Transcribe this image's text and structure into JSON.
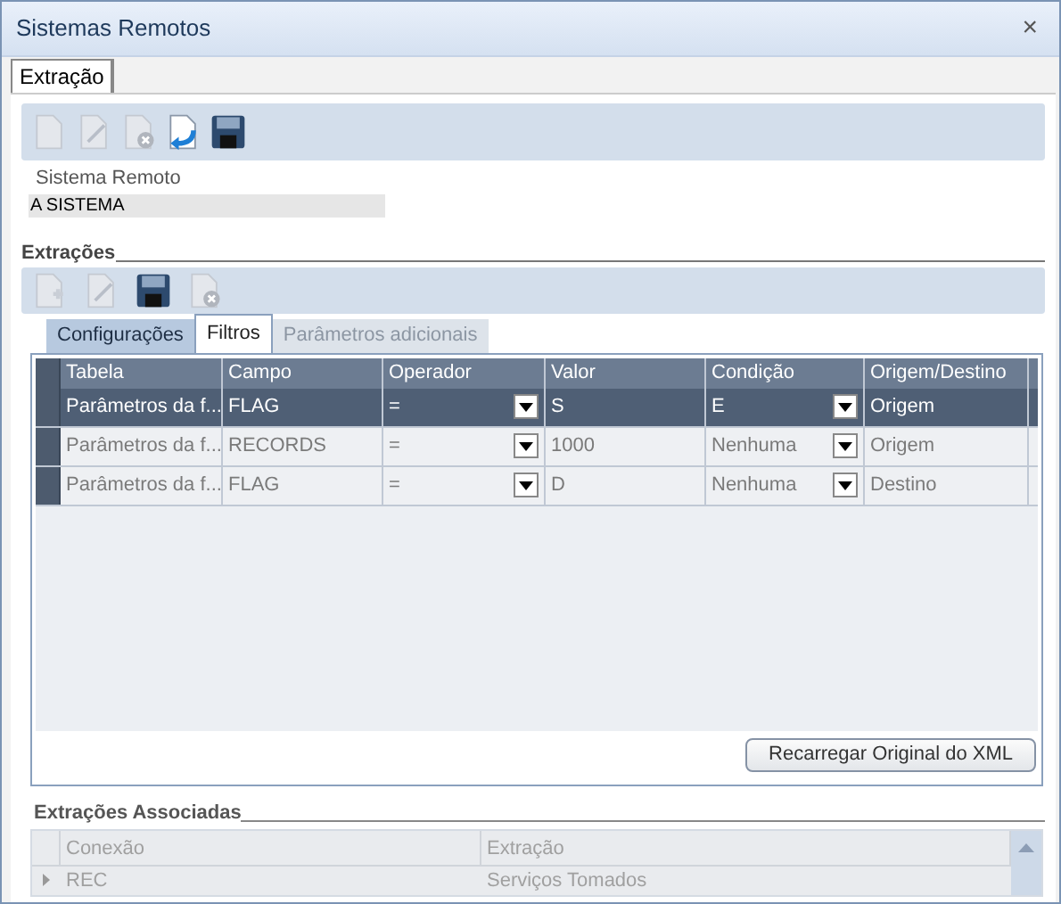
{
  "window": {
    "title": "Sistemas Remotos",
    "close": "×"
  },
  "tabs": [
    {
      "label": "Extração",
      "selected": true
    }
  ],
  "toolbar": [
    {
      "kind": "new",
      "disabled": true
    },
    {
      "kind": "edit",
      "disabled": true
    },
    {
      "kind": "delete",
      "disabled": true
    },
    {
      "kind": "undo",
      "disabled": false
    },
    {
      "kind": "save",
      "disabled": false
    }
  ],
  "sistema_remoto": {
    "label": "Sistema Remoto",
    "value": "A SISTEMA"
  },
  "extracoes": {
    "title": "Extrações",
    "toolbar": [
      {
        "kind": "add",
        "disabled": true
      },
      {
        "kind": "edit",
        "disabled": true
      },
      {
        "kind": "save",
        "disabled": false
      },
      {
        "kind": "delete",
        "disabled": true
      }
    ],
    "tabs": [
      {
        "label": "Configurações",
        "selected": false,
        "disabled": false
      },
      {
        "label": "Filtros",
        "selected": true,
        "disabled": false
      },
      {
        "label": "Parâmetros adicionais",
        "selected": false,
        "disabled": true
      }
    ],
    "table": {
      "columns": [
        "Tabela",
        "Campo",
        "Operador",
        "Valor",
        "Condição",
        "Origem/Destino"
      ],
      "rows": [
        {
          "selected": true,
          "cells": [
            "Parâmetros da f...",
            "FLAG",
            "=",
            "S",
            "E",
            "Origem"
          ]
        },
        {
          "selected": false,
          "cells": [
            "Parâmetros da f...",
            "RECORDS",
            "=",
            "1000",
            "Nenhuma",
            "Origem"
          ]
        },
        {
          "selected": false,
          "cells": [
            "Parâmetros da f...",
            "FLAG",
            "=",
            "D",
            "Nenhuma",
            "Destino"
          ]
        }
      ]
    },
    "reload_button": "Recarregar Original do XML"
  },
  "associadas": {
    "title": "Extrações Associadas",
    "columns": [
      "Conexão",
      "Extração"
    ],
    "rows": [
      {
        "cells": [
          "REC",
          "Serviços Tomados"
        ],
        "expanded": false
      }
    ]
  }
}
